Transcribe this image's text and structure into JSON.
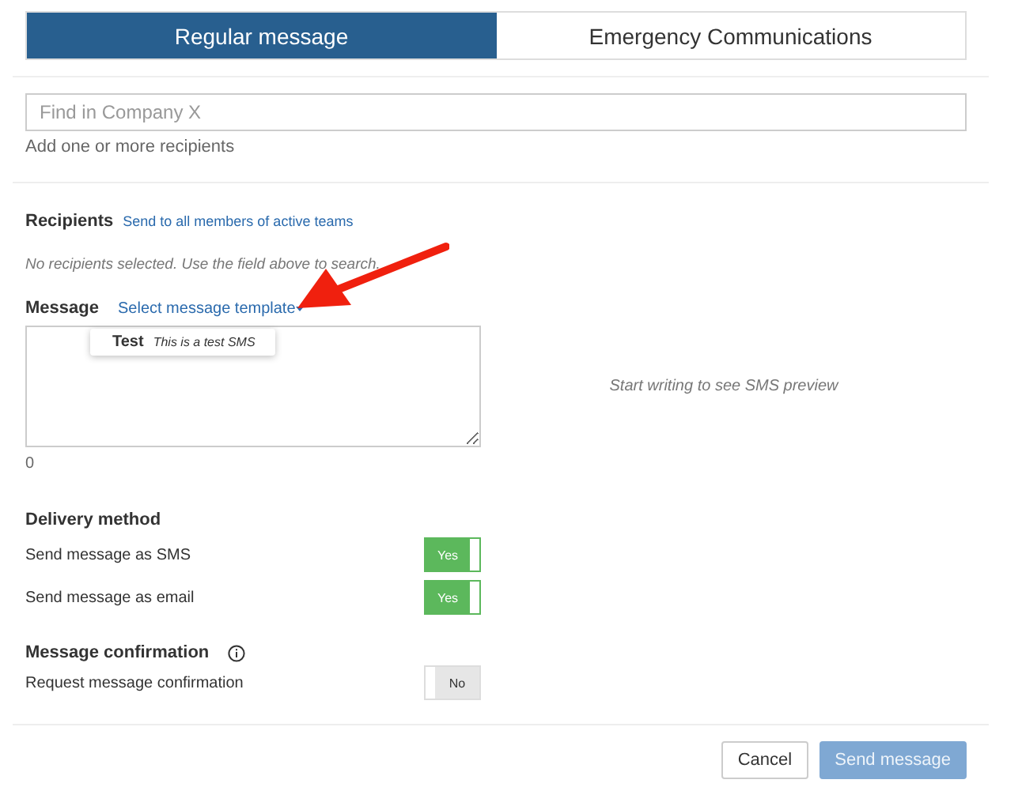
{
  "tabs": [
    {
      "label": "Regular message",
      "selected": true
    },
    {
      "label": "Emergency Communications",
      "selected": false
    }
  ],
  "search": {
    "placeholder": "Find in Company X",
    "hint": "Add one or more recipients"
  },
  "recipients": {
    "label": "Recipients",
    "link": "Send to all members of active teams",
    "empty_text": "No recipients selected. Use the field above to search."
  },
  "message": {
    "label": "Message",
    "template_link": "Select message template",
    "template_menu": [
      {
        "name": "Test",
        "text": "This is a test SMS"
      }
    ],
    "char_count": "0",
    "preview_text": "Start writing to see SMS preview"
  },
  "delivery": {
    "title": "Delivery method",
    "options": [
      {
        "label": "Send message as SMS",
        "on": true,
        "text": "Yes"
      },
      {
        "label": "Send message as email",
        "on": true,
        "text": "Yes"
      }
    ]
  },
  "confirmation": {
    "title": "Message confirmation",
    "options": [
      {
        "label": "Request message confirmation",
        "on": false,
        "text": "No"
      }
    ]
  },
  "buttons": [
    {
      "label": "Cancel",
      "kind": "secondary"
    },
    {
      "label": "Send message",
      "kind": "primary"
    }
  ]
}
